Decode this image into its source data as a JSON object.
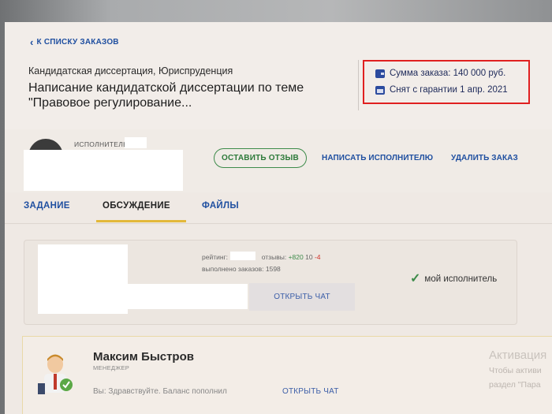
{
  "nav": {
    "back_label": "К СПИСКУ ЗАКАЗОВ"
  },
  "order": {
    "subject": "Кандидатская диссертация, Юриспруденция",
    "title_line1": "Написание кандидатской диссертации по теме",
    "title_line2": "\"Правовое регулирование...",
    "amount": "Сумма заказа: 140 000 руб.",
    "guarantee": "Снят с гарантии 1 апр. 2021"
  },
  "executor": {
    "label": "ИСПОЛНИТЕЛЬ",
    "review_button": "ОСТАВИТЬ ОТЗЫВ",
    "write_button": "НАПИСАТЬ ИСПОЛНИТЕЛЮ",
    "delete_button": "УДАЛИТЬ ЗАКАЗ"
  },
  "tabs": [
    {
      "label": "ЗАДАНИЕ",
      "active": false
    },
    {
      "label": "ОБСУЖДЕНИЕ",
      "active": true
    },
    {
      "label": "ФАЙЛЫ",
      "active": false
    }
  ],
  "executor_card": {
    "rating_label": "рейтинг:",
    "reviews_label": "отзывы:",
    "reviews_pos": "+820",
    "reviews_neu": "10",
    "reviews_neg": "-4",
    "completed": "выполнено заказов: 1598",
    "open_chat": "ОТКРЫТЬ ЧАТ",
    "my_executor": "мой исполнитель"
  },
  "manager": {
    "name": "Максим Быстров",
    "role": "МЕНЕДЖЕР",
    "last_message": "Вы: Здравствуйте. Баланс пополнил",
    "open_chat": "ОТКРЫТЬ ЧАТ"
  },
  "activation": {
    "title": "Активация",
    "line1": "Чтобы активи",
    "line2": "раздел \"Пара"
  },
  "colors": {
    "accent_blue": "#1f4fa0",
    "accent_green": "#3d8b4a",
    "highlight_red": "#e02020",
    "tab_underline": "#e3b83a"
  }
}
